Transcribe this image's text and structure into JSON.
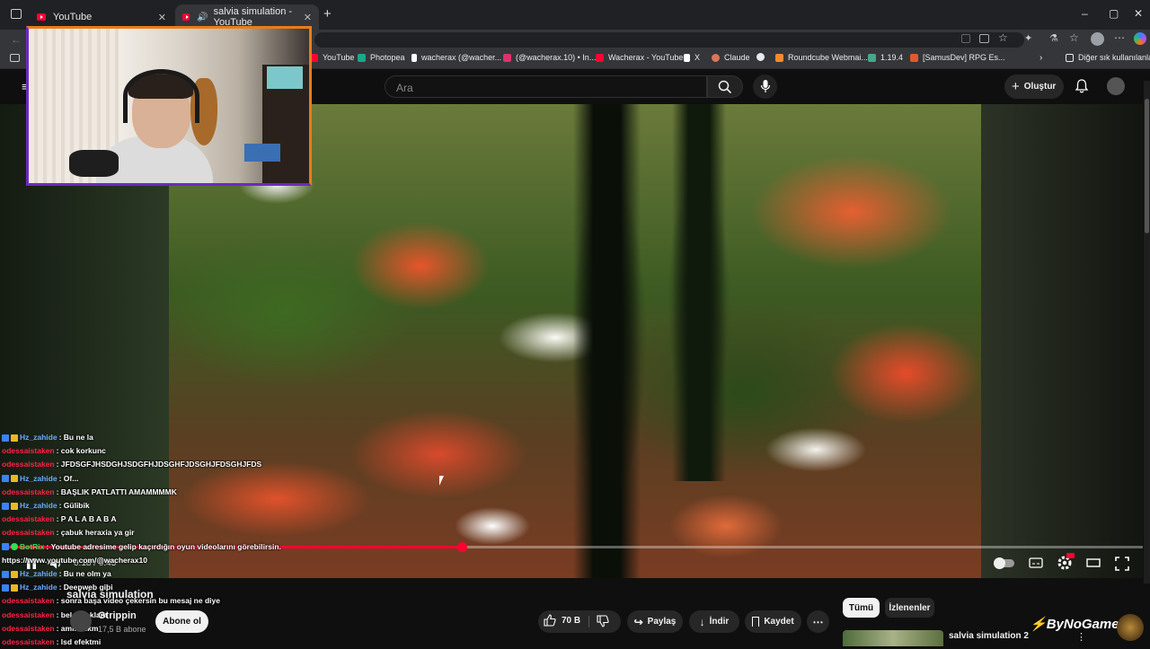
{
  "browser": {
    "tabs": [
      {
        "title": "YouTube",
        "active": false
      },
      {
        "title": "salvia simulation - YouTube",
        "active": true
      }
    ],
    "new_tab_symbol": "+",
    "window_controls": [
      "–",
      "▢",
      "✕"
    ]
  },
  "bookmarks": [
    {
      "label": "YouTube",
      "color": "#ff0033"
    },
    {
      "label": "Photopea",
      "color": "#19a88a"
    },
    {
      "label": "wacherax (@wacher...",
      "color": "#ffffff"
    },
    {
      "label": "(@wacherax.10) • In...",
      "color": "#e1306c"
    },
    {
      "label": "Wacherax - YouTube",
      "color": "#ff0033"
    },
    {
      "label": "X",
      "color": "#ffffff"
    },
    {
      "label": "Claude",
      "color": "#d97757"
    },
    {
      "label": "Roundcube Webmai...",
      "color": "#f28b30"
    },
    {
      "label": "1.19.4",
      "color": "#4aa58e"
    },
    {
      "label": "[SamusDev] RPG Es...",
      "color": "#e05a2b"
    }
  ],
  "bookmarks_other": "Diğer sık kullanılanlar",
  "youtube": {
    "search_placeholder": "Ara",
    "create_label": "Oluştur"
  },
  "player": {
    "current_time": "0:18",
    "duration": "0:45",
    "time_display": "0:18 / 0:45",
    "progress_fraction": 0.4,
    "progress_color": "#ff0033"
  },
  "chat": {
    "messages": [
      {
        "user": "Hz_zahide",
        "text": "Bu ne la",
        "color": "#66aaff",
        "badges": true
      },
      {
        "user": "odessaistaken",
        "text": "cok korkunc",
        "color": "#ff2244",
        "badges": false
      },
      {
        "user": "odessaistaken",
        "text": "JFDSGFJHSDGHJSDGFHJDSGHFJDSGHJFDSGHJFDS",
        "color": "#ff2244",
        "badges": false
      },
      {
        "user": "Hz_zahide",
        "text": "Of...",
        "color": "#66aaff",
        "badges": true
      },
      {
        "user": "odessaistaken",
        "text": "BAŞLIK PATLATTI AMAMMMMK",
        "color": "#ff2244",
        "badges": false
      },
      {
        "user": "Hz_zahide",
        "text": "Gülibik",
        "color": "#66aaff",
        "badges": true
      },
      {
        "user": "odessaistaken",
        "text": "P A L A B A B A",
        "color": "#ff2244",
        "badges": false
      },
      {
        "user": "odessaistaken",
        "text": "çabuk heraxia ya gir",
        "color": "#ff2244",
        "badges": false
      },
      {
        "user": "BotRix",
        "text": "Youtube adresime gelip kaçırdığın oyun videolarını görebilirsin.",
        "color": "#33dd55",
        "badges": true
      },
      {
        "user": "",
        "text": "https://www.youtube.com/@wacherax10",
        "color": "#ffffff",
        "badges": false
      },
      {
        "user": "Hz_zahide",
        "text": "Bu ne olm ya",
        "color": "#66aaff",
        "badges": true
      },
      {
        "user": "Hz_zahide",
        "text": "Deepweb gibi",
        "color": "#66aaff",
        "badges": true
      },
      {
        "user": "odessaistaken",
        "text": "sonra başa video çekersin bu mesaj ne diye",
        "color": "#ff2244",
        "badges": false
      },
      {
        "user": "odessaistaken",
        "text": "beleş reklam",
        "color": "#ff2244",
        "badges": false
      },
      {
        "user": "odessaistaken",
        "text": "aminisikm",
        "color": "#ff2244",
        "badges": false
      },
      {
        "user": "odessaistaken",
        "text": "lsd efektmi",
        "color": "#ff2244",
        "badges": false
      }
    ]
  },
  "video_info": {
    "title": "salvia simulation",
    "channel": "Gtrippin",
    "subscribers": "17,5 B abone",
    "subscribe_label": "Abone ol",
    "likes": "70 B",
    "share_label": "Paylaş",
    "download_label": "İndir",
    "save_label": "Kaydet"
  },
  "sidebar": {
    "chips": [
      "Tümü",
      "İzlenenler"
    ],
    "recommendations": [
      {
        "title": "salvia simulation 2"
      }
    ]
  },
  "overlay": {
    "watermark": "ByNoGame"
  }
}
